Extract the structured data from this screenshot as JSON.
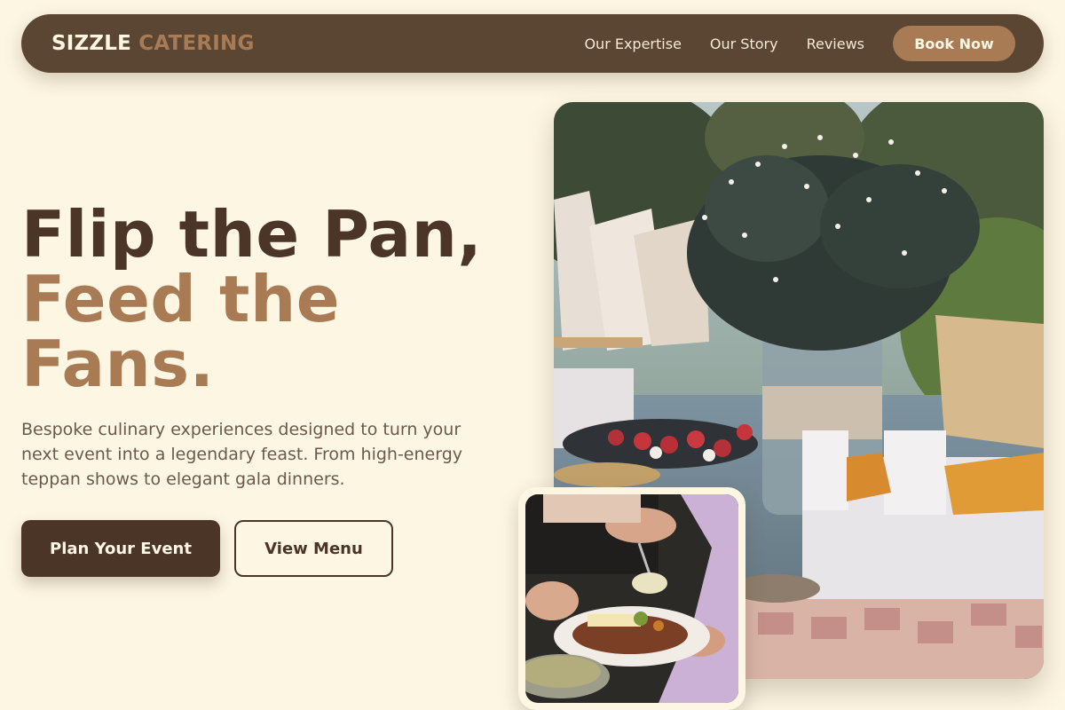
{
  "nav": {
    "brand_part1": "SIZZLE",
    "brand_part2": "CATERING",
    "links": [
      "Our Expertise",
      "Our Story",
      "Reviews"
    ],
    "cta": "Book Now"
  },
  "hero": {
    "title_line1": "Flip the Pan,",
    "title_line2": "Feed the Fans.",
    "description": "Bespoke culinary experiences designed to turn your next event into a legendary feast. From high-energy teppan shows to elegant gala dinners.",
    "primary_button": "Plan Your Event",
    "secondary_button": "View Menu"
  },
  "colors": {
    "background": "#fdf6e3",
    "nav_bg": "#5a4632",
    "accent": "#a87b55",
    "dark": "#4a3526"
  }
}
